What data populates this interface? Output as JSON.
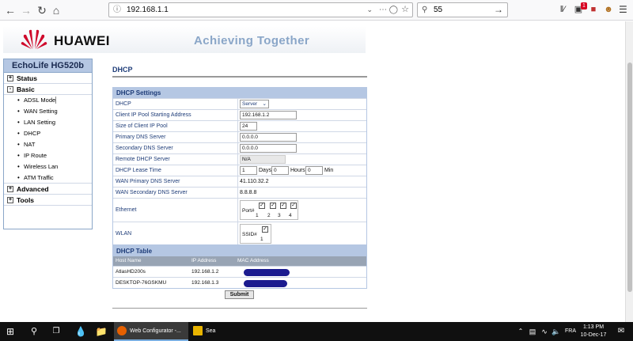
{
  "browser": {
    "url": "192.168.1.1",
    "search_value": "55",
    "badge_count": "1"
  },
  "header": {
    "brand": "HUAWEI",
    "tagline": "Achieving Together"
  },
  "sidebar": {
    "title": "EchoLife HG520b",
    "items": [
      {
        "label": "Status",
        "type": "top",
        "box": "+"
      },
      {
        "label": "Basic",
        "type": "top",
        "box": "-"
      },
      {
        "label": "ADSL Mode",
        "type": "sub"
      },
      {
        "label": "WAN Setting",
        "type": "sub"
      },
      {
        "label": "LAN Setting",
        "type": "sub"
      },
      {
        "label": "DHCP",
        "type": "sub"
      },
      {
        "label": "NAT",
        "type": "sub"
      },
      {
        "label": "IP Route",
        "type": "sub"
      },
      {
        "label": "Wireless Lan",
        "type": "sub"
      },
      {
        "label": "ATM Traffic",
        "type": "sub"
      },
      {
        "label": "Advanced",
        "type": "top",
        "box": "+"
      },
      {
        "label": "Tools",
        "type": "top",
        "box": "+"
      }
    ]
  },
  "main": {
    "title": "DHCP",
    "settings_heading": "DHCP Settings",
    "fields": {
      "dhcp": {
        "label": "DHCP",
        "value": "Server"
      },
      "pool_start": {
        "label": "Client IP Pool Starting Address",
        "value": "192.168.1.2"
      },
      "pool_size": {
        "label": "Size of Client IP Pool",
        "value": "24"
      },
      "primary_dns": {
        "label": "Primary DNS Server",
        "value": "0.0.0.0"
      },
      "secondary_dns": {
        "label": "Secondary DNS Server",
        "value": "0.0.0.0"
      },
      "remote_dhcp": {
        "label": "Remote DHCP Server",
        "value": "N/A"
      },
      "lease": {
        "label": "DHCP Lease Time",
        "days": "1",
        "days_label": "Days",
        "hours": "0",
        "hours_label": "Hours",
        "mins": "0",
        "mins_label": "Min"
      },
      "wan_primary_dns": {
        "label": "WAN Primary DNS Server",
        "value": "41.110.32.2"
      },
      "wan_secondary_dns": {
        "label": "WAN Secondary DNS Server",
        "value": "8.8.8.8"
      },
      "ethernet": {
        "label": "Ethernet",
        "prefix": "Port#",
        "ports": [
          "1",
          "2",
          "3",
          "4"
        ]
      },
      "wlan": {
        "label": "WLAN",
        "prefix": "SSID#",
        "ssids": [
          "1"
        ]
      }
    },
    "table_heading": "DHCP Table",
    "table_columns": [
      "Host Name",
      "IP Address",
      "MAC Address"
    ],
    "table_rows": [
      {
        "host": "AtlasHD200s",
        "ip": "192.168.1.2"
      },
      {
        "host": "DESKTOP-76GSKMU",
        "ip": "192.168.1.3"
      }
    ],
    "submit_label": "Submit"
  },
  "taskbar": {
    "tasks": [
      {
        "label": "Web Configurator -...",
        "color": "#e66000"
      },
      {
        "label": "Sea",
        "color": "#e8b400"
      }
    ],
    "language": "FRA",
    "time": "1:13 PM",
    "date": "10-Dec-17"
  },
  "colors": {
    "accent_blue": "#b5c7e3",
    "title_blue": "#1e3c78",
    "huawei_red": "#cf0a2c"
  }
}
